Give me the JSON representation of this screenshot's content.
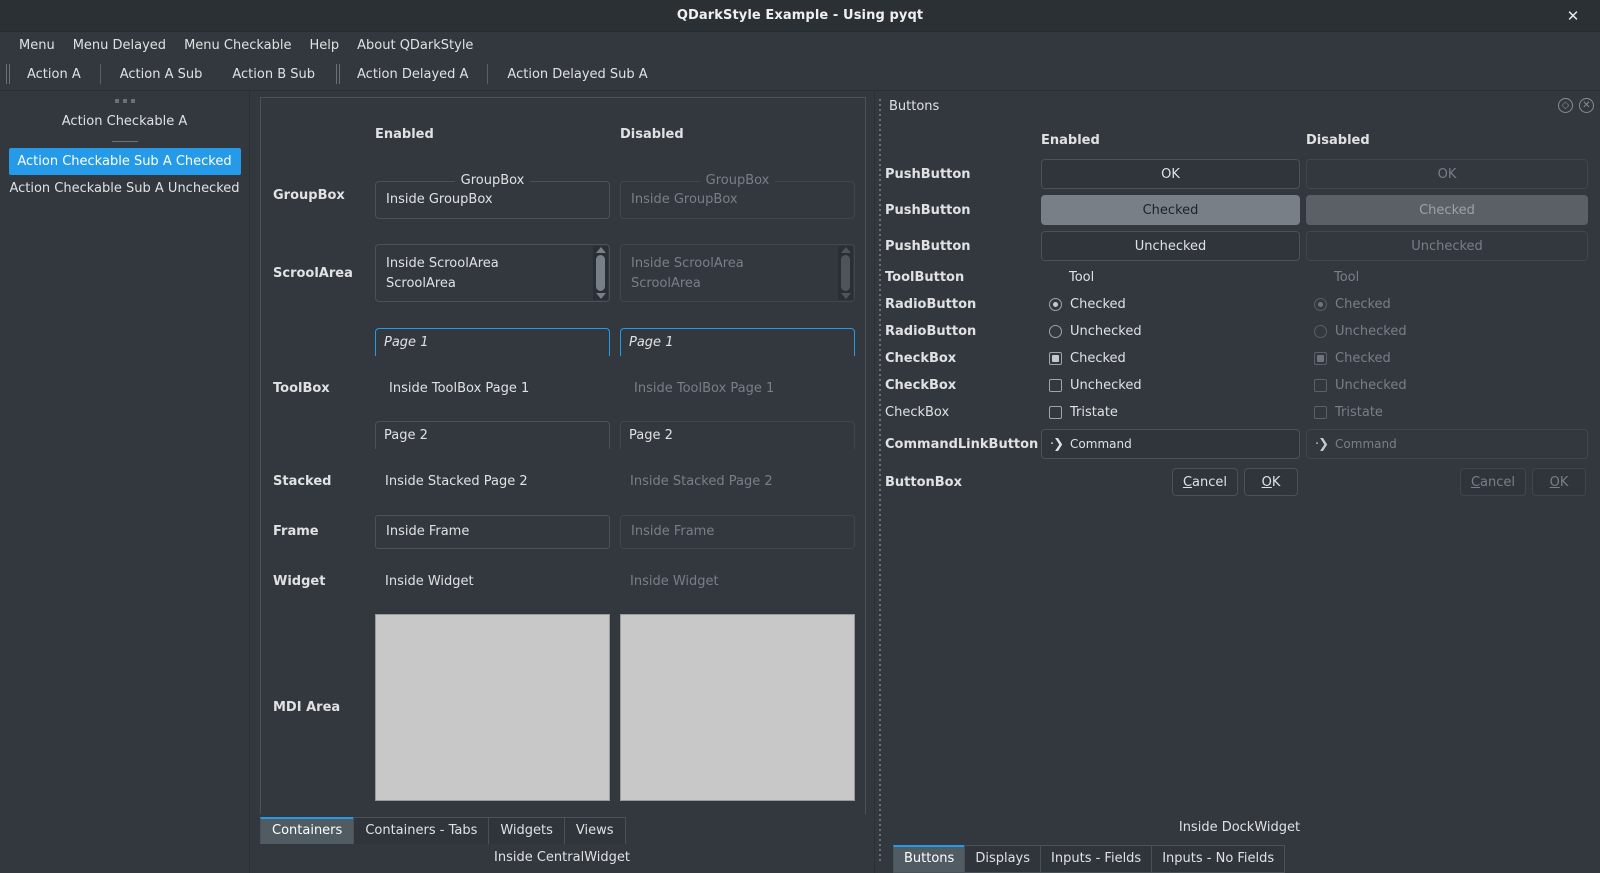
{
  "window": {
    "title": "QDarkStyle Example - Using pyqt",
    "close_icon": "close-icon",
    "close_glyph": "✕"
  },
  "menubar": {
    "items": [
      {
        "label": "Menu"
      },
      {
        "label": "Menu Delayed"
      },
      {
        "label": "Menu Checkable"
      },
      {
        "label": "Help"
      },
      {
        "label": "About QDarkStyle"
      }
    ]
  },
  "toolbar_main": {
    "actions": [
      {
        "label": "Action A"
      },
      {
        "label": "Action A Sub"
      },
      {
        "label": "Action B Sub"
      }
    ]
  },
  "toolbar_delayed": {
    "actions": [
      {
        "label": "Action Delayed A"
      },
      {
        "label": "Action Delayed Sub A"
      }
    ]
  },
  "toolbar_vertical": {
    "actions": [
      {
        "label": "Action Checkable A",
        "checked": false
      },
      {
        "label": "Action Checkable Sub A Checked",
        "checked": true
      },
      {
        "label": "Action Checkable Sub A Unchecked",
        "checked": false
      }
    ]
  },
  "central": {
    "columns": {
      "enabled": "Enabled",
      "disabled": "Disabled"
    },
    "rows": {
      "groupbox": {
        "label": "GroupBox",
        "title": "GroupBox",
        "content": "Inside GroupBox"
      },
      "scrollarea": {
        "label": "ScroolArea",
        "line1": "Inside ScroolArea",
        "line2": "ScroolArea"
      },
      "toolbox": {
        "label": "ToolBox",
        "page1": "Page 1",
        "content": "Inside ToolBox Page 1",
        "page2": "Page 2"
      },
      "stacked": {
        "label": "Stacked",
        "content": "Inside Stacked Page 2"
      },
      "frame": {
        "label": "Frame",
        "content": "Inside Frame"
      },
      "widget": {
        "label": "Widget",
        "content": "Inside Widget"
      },
      "mdi": {
        "label": "MDI Area"
      }
    },
    "tabs": [
      {
        "label": "Containers",
        "active": true
      },
      {
        "label": "Containers - Tabs",
        "active": false
      },
      {
        "label": "Widgets",
        "active": false
      },
      {
        "label": "Views",
        "active": false
      }
    ],
    "status": "Inside CentralWidget"
  },
  "dock": {
    "title": "Buttons",
    "float_icon": "float-icon",
    "float_glyph": "◇",
    "close_icon": "close-icon",
    "close_glyph": "✕",
    "columns": {
      "enabled": "Enabled",
      "disabled": "Disabled"
    },
    "rows": [
      {
        "label": "PushButton",
        "enabled_text": "OK",
        "disabled_text": "OK",
        "state": "normal"
      },
      {
        "label": "PushButton",
        "enabled_text": "Checked",
        "disabled_text": "Checked",
        "state": "checked"
      },
      {
        "label": "PushButton",
        "enabled_text": "Unchecked",
        "disabled_text": "Unchecked",
        "state": "normal"
      }
    ],
    "toolbutton": {
      "label": "ToolButton",
      "enabled_text": "Tool",
      "disabled_text": "Tool"
    },
    "radios": [
      {
        "label": "RadioButton",
        "text": "Checked",
        "checked": true
      },
      {
        "label": "RadioButton",
        "text": "Unchecked",
        "checked": false
      }
    ],
    "checkboxes": [
      {
        "label": "CheckBox",
        "text": "Checked",
        "checked": true,
        "thin": false
      },
      {
        "label": "CheckBox",
        "text": "Unchecked",
        "checked": false,
        "thin": false
      },
      {
        "label": "CheckBox",
        "text": "Tristate",
        "checked": false,
        "thin": true
      }
    ],
    "commandlink": {
      "label": "CommandLinkButton",
      "text": "Command",
      "arrow": "·❯"
    },
    "buttonbox": {
      "label": "ButtonBox",
      "cancel_mn": "C",
      "cancel_rest": "ancel",
      "ok_mn": "O",
      "ok_rest": "K"
    },
    "status": "Inside DockWidget",
    "tabs": [
      {
        "label": "Buttons",
        "active": true
      },
      {
        "label": "Displays",
        "active": false
      },
      {
        "label": "Inputs - Fields",
        "active": false
      },
      {
        "label": "Inputs - No Fields",
        "active": false
      }
    ]
  },
  "colors": {
    "background": "#32383e",
    "window_bg": "#19232d",
    "accent": "#259ae9",
    "border": "#4a5157",
    "text": "#e0e1e3",
    "disabled_text": "#787f86",
    "checked_bg": "#787f86",
    "mdi_bg": "#c8c8c8"
  }
}
